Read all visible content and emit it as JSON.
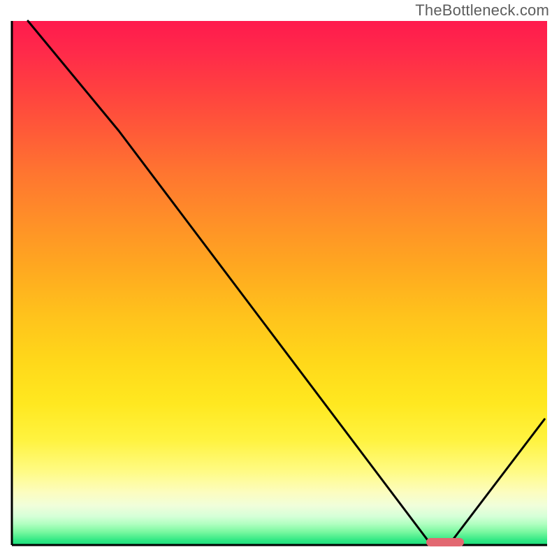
{
  "watermark": "TheBottleneck.com",
  "chart_data": {
    "type": "line",
    "title": "",
    "xlabel": "",
    "ylabel": "",
    "xlim": [
      0,
      100
    ],
    "ylim": [
      0,
      100
    ],
    "x": [
      3,
      20,
      78,
      82,
      99.5
    ],
    "values": [
      100,
      79,
      0.5,
      0.5,
      24
    ],
    "marker": {
      "x_start": 78,
      "x_end": 84,
      "y": 0.5
    },
    "background_gradient": {
      "type": "vertical",
      "stops": [
        {
          "pos": 0,
          "color": "#ff1a4d"
        },
        {
          "pos": 0.5,
          "color": "#ffb81e"
        },
        {
          "pos": 0.85,
          "color": "#fffb85"
        },
        {
          "pos": 1.0,
          "color": "#19e07c"
        }
      ]
    }
  }
}
